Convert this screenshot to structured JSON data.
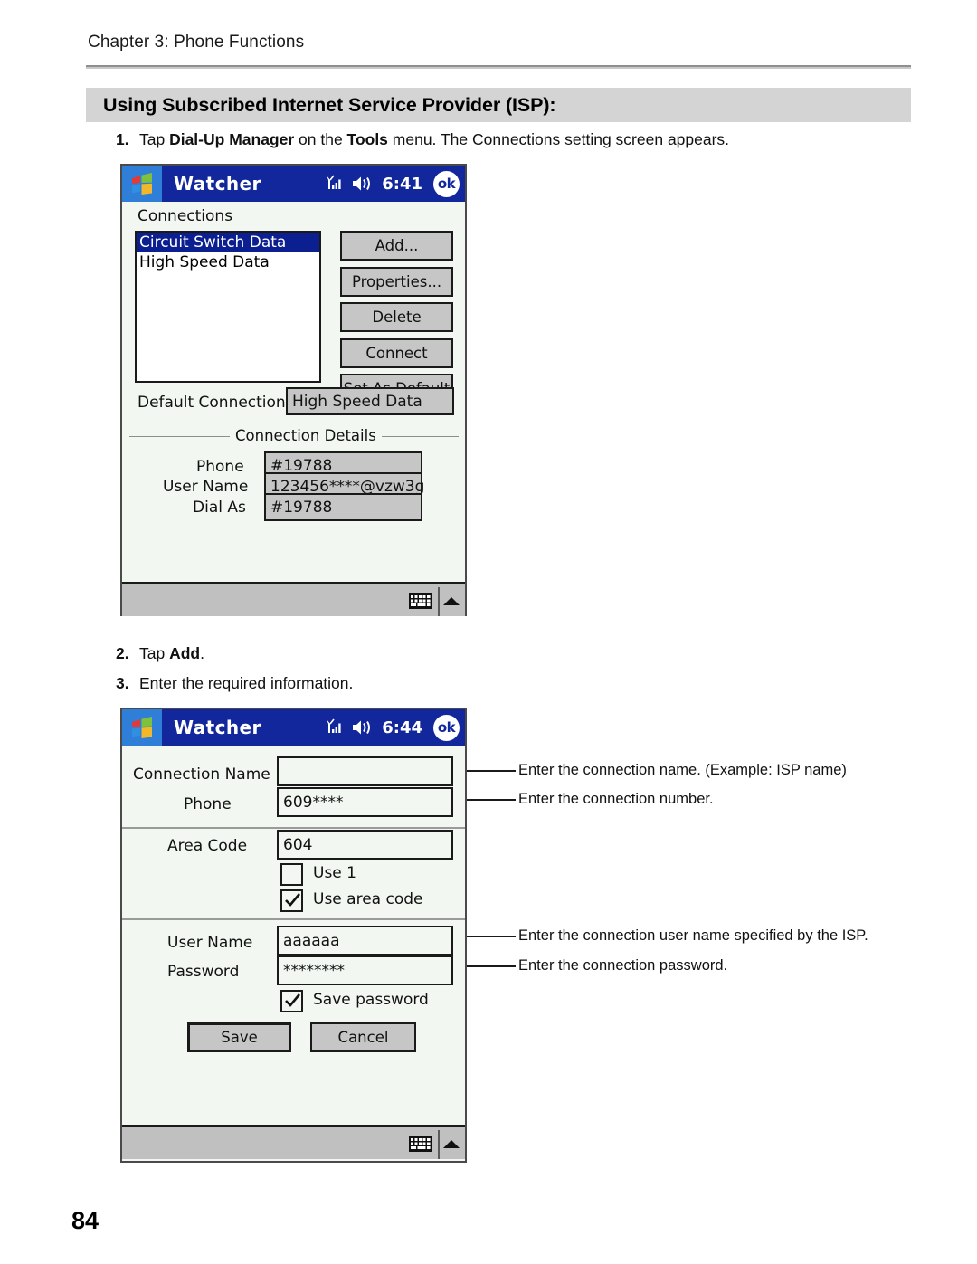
{
  "document": {
    "chapter_header": "Chapter 3: Phone Functions",
    "section_title": "Using Subscribed Internet Service Provider (ISP):",
    "page_number": "84",
    "steps": [
      {
        "num": "1.",
        "html": "Tap <b>Dial-Up Manager</b> on the <b>Tools</b> menu. The Connections setting screen appears."
      },
      {
        "num": "2.",
        "html": "Tap <b>Add</b>."
      },
      {
        "num": "3.",
        "html": "Enter the required information."
      }
    ]
  },
  "annotations": [
    {
      "text": "Enter the connection name. (Example: ISP name)"
    },
    {
      "text": "Enter the connection number."
    },
    {
      "text": "Enter the connection user name specified by the ISP."
    },
    {
      "text": "Enter the connection password."
    }
  ],
  "screenshot_connections": {
    "titlebar": {
      "app_title": "Watcher",
      "clock": "6:41",
      "ok_label": "ok",
      "icons": [
        "windows-logo-icon",
        "signal-bars-icon",
        "speaker-icon"
      ]
    },
    "list_label": "Connections",
    "list_items": [
      {
        "label": "Circuit Switch Data",
        "selected": true
      },
      {
        "label": "High Speed Data",
        "selected": false
      }
    ],
    "buttons": [
      {
        "label": "Add..."
      },
      {
        "label": "Properties..."
      },
      {
        "label": "Delete"
      },
      {
        "label": "Connect"
      },
      {
        "label": "Set As Default"
      }
    ],
    "default_connection": {
      "label": "Default Connection",
      "value": "High Speed Data"
    },
    "connection_details": {
      "group_label": "Connection Details",
      "fields": [
        {
          "label": "Phone",
          "value": "#19788"
        },
        {
          "label": "User Name",
          "value": "123456****@vzw3g"
        },
        {
          "label": "Dial As",
          "value": "#19788"
        }
      ]
    },
    "statusbar": {
      "icons": [
        "keyboard-icon",
        "up-arrow-icon"
      ]
    }
  },
  "screenshot_new_connection": {
    "titlebar": {
      "app_title": "Watcher",
      "clock": "6:44",
      "ok_label": "ok",
      "icons": [
        "windows-logo-icon",
        "signal-bars-icon",
        "speaker-icon"
      ]
    },
    "section_top": {
      "fields": [
        {
          "label": "Connection Name",
          "value": "",
          "placeholder": ""
        },
        {
          "label": "Phone",
          "value": "609****"
        }
      ]
    },
    "section_area": {
      "field": {
        "label": "Area Code",
        "value": "604"
      },
      "checkboxes": [
        {
          "label": "Use 1",
          "checked": false
        },
        {
          "label": "Use area code",
          "checked": true
        }
      ]
    },
    "section_credentials": {
      "fields": [
        {
          "label": "User Name",
          "value": "aaaaaa"
        },
        {
          "label": "Password",
          "value": "********"
        }
      ],
      "checkbox": {
        "label": "Save password",
        "checked": true
      },
      "buttons": [
        {
          "label": "Save",
          "default": true
        },
        {
          "label": "Cancel",
          "default": false
        }
      ]
    },
    "statusbar": {
      "icons": [
        "keyboard-icon",
        "up-arrow-icon"
      ]
    }
  },
  "colors": {
    "titlebar_blue": "#11279b",
    "logo_blue": "#2f7fd8",
    "selection_blue": "#0b1f91",
    "button_gray": "#c6c6c6",
    "client_bg": "#f2f7f2",
    "band_gray": "#d4d4d4",
    "statusbar_gray": "#c0c0c0"
  }
}
